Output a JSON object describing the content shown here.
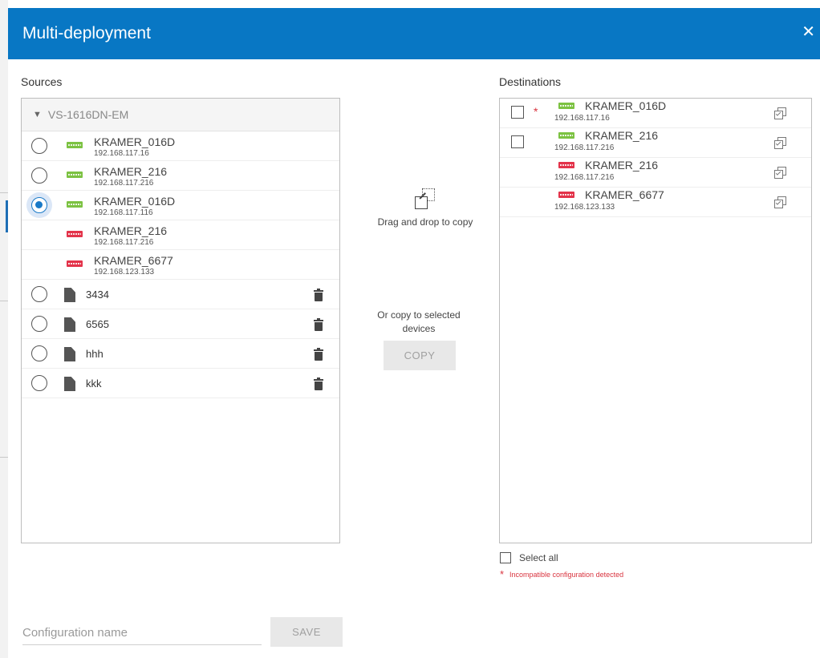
{
  "dialog": {
    "title": "Multi-deployment",
    "close_glyph": "✕"
  },
  "sources": {
    "label": "Sources",
    "group": {
      "name": "VS-1616DN-EM",
      "chevron": "⌄"
    },
    "devices": [
      {
        "name": "KRAMER_016D",
        "ip": "192.168.117.16",
        "status": "compatible",
        "radio": true,
        "selected": false
      },
      {
        "name": "KRAMER_216",
        "ip": "192.168.117.216",
        "status": "compatible",
        "radio": true,
        "selected": false
      },
      {
        "name": "KRAMER_016D",
        "ip": "192.168.117.116",
        "status": "compatible",
        "radio": true,
        "selected": true
      },
      {
        "name": "KRAMER_216",
        "ip": "192.168.117.216",
        "status": "incompatible",
        "radio": false,
        "selected": false
      },
      {
        "name": "KRAMER_6677",
        "ip": "192.168.123.133",
        "status": "incompatible",
        "radio": false,
        "selected": false
      }
    ],
    "configs": [
      {
        "name": "3434"
      },
      {
        "name": "6565"
      },
      {
        "name": "hhh"
      },
      {
        "name": "kkk"
      }
    ]
  },
  "middle": {
    "drag_text": "Drag and drop to copy",
    "or_copy_text_line1": "Or copy to selected",
    "or_copy_text_line2": "devices",
    "copy_button": "COPY"
  },
  "destinations": {
    "label": "Destinations",
    "devices": [
      {
        "name": "KRAMER_016D",
        "ip": "192.168.117.16",
        "status": "compatible",
        "checkbox": true,
        "warning": true
      },
      {
        "name": "KRAMER_216",
        "ip": "192.168.117.216",
        "status": "compatible",
        "checkbox": true,
        "warning": false
      },
      {
        "name": "KRAMER_216",
        "ip": "192.168.117.216",
        "status": "incompatible",
        "checkbox": false,
        "warning": false
      },
      {
        "name": "KRAMER_6677",
        "ip": "192.168.123.133",
        "status": "incompatible",
        "checkbox": false,
        "warning": false
      }
    ],
    "select_all": "Select all",
    "warning_star": "*",
    "warning_text": "Incompatible configuration detected"
  },
  "footer": {
    "config_name_placeholder": "Configuration name",
    "save_button": "SAVE"
  },
  "colors": {
    "header": "#0877c4",
    "compatible": "#7cc242",
    "incompatible": "#e3334a",
    "accent": "#1a7ac7",
    "warning": "#d9343f"
  },
  "icons": [
    "close-icon",
    "chevron-down-icon",
    "device-icon",
    "file-icon",
    "trash-icon",
    "copy-config-icon",
    "drag-drop-icon"
  ]
}
